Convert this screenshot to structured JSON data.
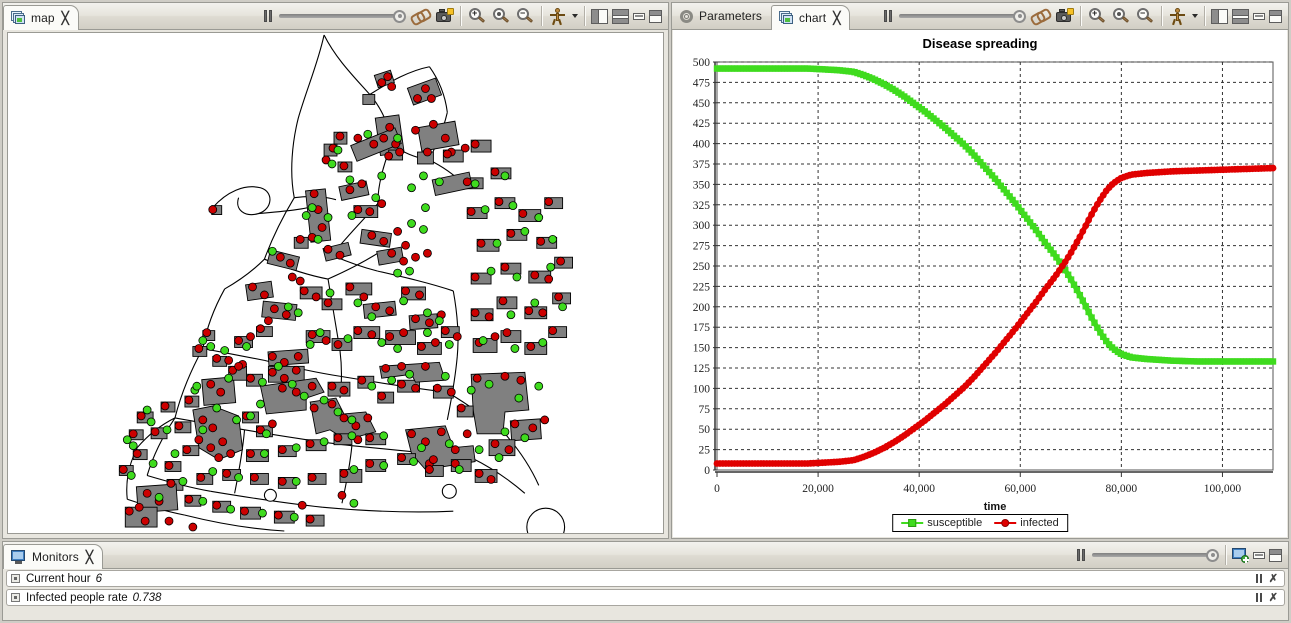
{
  "map_panel": {
    "tab": {
      "label": "map",
      "icon": "view-icon",
      "close": "╳"
    },
    "toolbar": {
      "pause_label": "pause",
      "slider_label": "speed-slider",
      "link_label": "link-views",
      "snapshot_label": "snapshot",
      "zoom_in_label": "zoom-in",
      "zoom_fit_label": "zoom-fit",
      "zoom_out_label": "zoom-out",
      "agents_label": "agents",
      "layout_left_label": "layout-left",
      "layout_top_label": "layout-top",
      "minimize_label": "minimize",
      "maximize_label": "maximize"
    }
  },
  "chart_panel": {
    "tabs": [
      {
        "label": "Parameters",
        "icon": "gear-icon",
        "active": false
      },
      {
        "label": "chart",
        "icon": "view-icon",
        "active": true,
        "close": "╳"
      }
    ],
    "toolbar": {
      "pause_label": "pause",
      "slider_label": "speed-slider",
      "link_label": "link-views",
      "snapshot_label": "snapshot",
      "zoom_in_label": "zoom-in",
      "zoom_fit_label": "zoom-fit",
      "zoom_out_label": "zoom-out",
      "agents_label": "agents",
      "layout_left_label": "layout-left",
      "layout_top_label": "layout-top",
      "minimize_label": "minimize",
      "maximize_label": "maximize"
    }
  },
  "monitors_panel": {
    "tab": {
      "label": "Monitors",
      "icon": "monitor-icon",
      "close": "╳"
    },
    "toolbar": {
      "pause_label": "pause",
      "slider_label": "speed-slider",
      "add_monitor_label": "add-monitor",
      "minimize_label": "minimize",
      "maximize_label": "maximize"
    },
    "rows": [
      {
        "name": "Current hour",
        "value": "6"
      },
      {
        "name": "Infected people rate",
        "value": "0.738"
      }
    ]
  },
  "chart_data": {
    "type": "line",
    "title": "Disease spreading",
    "xlabel": "time",
    "ylabel": "",
    "xlim": [
      0,
      110000
    ],
    "ylim": [
      0,
      500
    ],
    "grid": true,
    "legend_position": "bottom",
    "xticks": [
      0,
      20000,
      40000,
      60000,
      80000,
      100000
    ],
    "xtick_labels": [
      "0",
      "20,000",
      "40,000",
      "60,000",
      "80,000",
      "100,000"
    ],
    "yticks": [
      0,
      25,
      50,
      75,
      100,
      125,
      150,
      175,
      200,
      225,
      250,
      275,
      300,
      325,
      350,
      375,
      400,
      425,
      450,
      475,
      500
    ],
    "ytick_labels": [
      "0",
      "25",
      "50",
      "75",
      "100",
      "125",
      "150",
      "175",
      "200",
      "225",
      "250",
      "275",
      "300",
      "325",
      "350",
      "375",
      "400",
      "425",
      "450",
      "475",
      "500"
    ],
    "series": [
      {
        "name": "susceptible",
        "color": "#3FDB1E",
        "marker": "square",
        "x": [
          0,
          3000,
          6000,
          9000,
          12000,
          15000,
          18000,
          21000,
          24000,
          27000,
          29000,
          31000,
          33000,
          35000,
          37000,
          39000,
          41000,
          43000,
          45000,
          47000,
          49000,
          51000,
          53000,
          55000,
          57000,
          59000,
          61000,
          63000,
          65000,
          66000,
          67000,
          68000,
          69000,
          70000,
          71000,
          72000,
          73000,
          74000,
          75000,
          76000,
          77000,
          78000,
          79000,
          80000,
          82000,
          85000,
          90000,
          95000,
          100000,
          105000,
          110000
        ],
        "y": [
          492,
          492,
          492,
          492,
          492,
          492,
          492,
          491,
          490,
          488,
          484,
          479,
          473,
          466,
          458,
          449,
          440,
          430,
          420,
          409,
          398,
          385,
          371,
          357,
          342,
          327,
          311,
          295,
          278,
          270,
          262,
          253,
          244,
          234,
          223,
          212,
          200,
          188,
          177,
          167,
          158,
          151,
          146,
          142,
          138,
          136,
          134,
          133,
          133,
          133,
          133
        ]
      },
      {
        "name": "infected",
        "color": "#E00000",
        "marker": "circle",
        "x": [
          0,
          3000,
          6000,
          9000,
          12000,
          15000,
          18000,
          21000,
          24000,
          27000,
          29000,
          31000,
          33000,
          35000,
          37000,
          39000,
          41000,
          43000,
          45000,
          47000,
          49000,
          51000,
          53000,
          55000,
          57000,
          59000,
          61000,
          63000,
          65000,
          66000,
          67000,
          68000,
          69000,
          70000,
          71000,
          72000,
          73000,
          74000,
          75000,
          76000,
          77000,
          78000,
          79000,
          80000,
          82000,
          85000,
          90000,
          95000,
          100000,
          105000,
          110000
        ],
        "y": [
          8,
          8,
          8,
          8,
          8,
          8,
          8,
          9,
          10,
          12,
          16,
          21,
          27,
          34,
          42,
          51,
          60,
          70,
          80,
          91,
          102,
          115,
          129,
          143,
          158,
          173,
          189,
          205,
          222,
          230,
          238,
          247,
          256,
          266,
          277,
          288,
          300,
          312,
          323,
          333,
          342,
          349,
          354,
          358,
          362,
          364,
          366,
          367,
          368,
          369,
          370
        ]
      }
    ]
  },
  "map_data": {
    "background": "#ffffff",
    "building_color": "#808080",
    "road_color": "#000000",
    "agent_infected_color": "#cc0000",
    "agent_susceptible_color": "#3fdb1e"
  }
}
